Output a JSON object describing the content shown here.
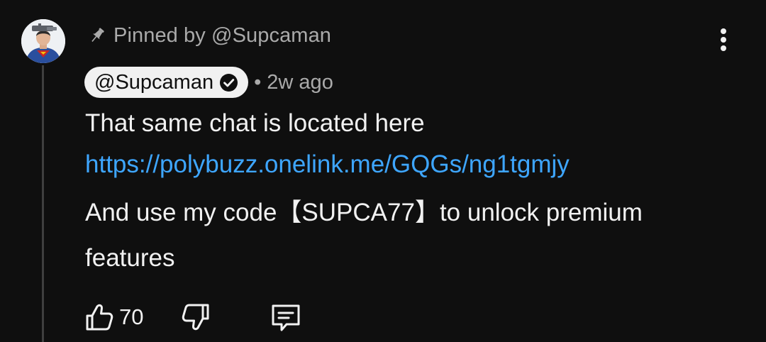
{
  "pinned": {
    "text": "Pinned by @Supcaman",
    "icon": "pin-icon"
  },
  "comment": {
    "author": "@Supcaman",
    "verified": true,
    "time": "• 2w ago",
    "line1": "That same chat is located here",
    "link": "https://polybuzz.onelink.me/GQGs/ng1tgmjy",
    "line2": "And use my code【SUPCA77】to unlock premium features"
  },
  "actions": {
    "like_count": "70",
    "like_icon": "thumbs-up-icon",
    "dislike_icon": "thumbs-down-icon",
    "reply_icon": "comment-icon"
  },
  "menu": {
    "icon": "more-vertical-icon"
  },
  "colors": {
    "background": "#0f0f0f",
    "text_primary": "#f1f1f1",
    "text_secondary": "#aaaaaa",
    "link": "#3ea6ff",
    "author_badge_bg": "#f1f1f1"
  }
}
